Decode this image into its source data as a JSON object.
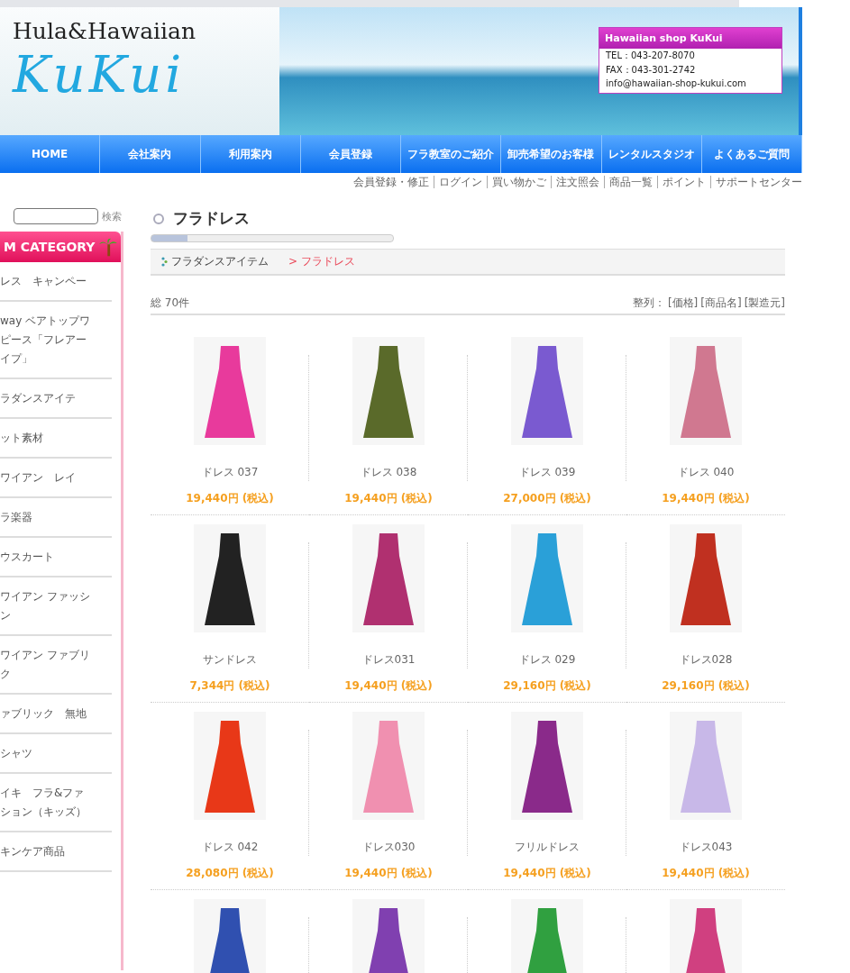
{
  "header": {
    "logo_top": "Hula&Hawaiian",
    "logo_main": "KuKui",
    "info": {
      "title": "Hawaiian shop KuKui",
      "lines": [
        "TEL：043-207-8070",
        "FAX：043-301-2742",
        "info@hawaiian-shop-kukui.com"
      ]
    }
  },
  "nav": [
    "HOME",
    "会社案内",
    "利用案内",
    "会員登録",
    "フラ教室のご紹介",
    "卸売希望のお客様",
    "レンタルスタジオ",
    "よくあるご質問"
  ],
  "sub_links": [
    "会員登録・修正",
    "ログイン",
    "買い物かご",
    "注文照会",
    "商品一覧",
    "ポイント",
    "サポートセンター"
  ],
  "sidebar": {
    "search_button": "検索",
    "category_title": "M CATEGORY",
    "items": [
      {
        "lines": [
          "レス　キャンペー"
        ]
      },
      {
        "lines": [
          "way ベアトップワ",
          "ピース「フレアー",
          "イプ」"
        ]
      },
      {
        "lines": [
          "ラダンスアイテ"
        ]
      },
      {
        "lines": [
          "ット素材"
        ]
      },
      {
        "lines": [
          "ワイアン　レイ"
        ]
      },
      {
        "lines": [
          "ラ楽器"
        ]
      },
      {
        "lines": [
          "ウスカート"
        ]
      },
      {
        "lines": [
          "ワイアン ファッシ",
          "ン"
        ]
      },
      {
        "lines": [
          "ワイアン ファブリ",
          "ク"
        ]
      },
      {
        "lines": [
          "ァブリック　無地"
        ]
      },
      {
        "lines": [
          "シャツ"
        ]
      },
      {
        "lines": [
          "イキ　フラ&ファ",
          "ション（キッズ）"
        ]
      },
      {
        "lines": [
          "キンケア商品"
        ]
      }
    ]
  },
  "page_title": "フラドレス",
  "breadcrumb": {
    "parent": "フラダンスアイテム",
    "current": "> フラドレス"
  },
  "count": "総 70件",
  "sort": {
    "label": "整列：",
    "options": [
      "[価格]",
      "[商品名]",
      "[製造元]"
    ]
  },
  "products": [
    {
      "name": "ドレス 037",
      "price": "19,440円 (税込)",
      "color": "#e83a9c"
    },
    {
      "name": "ドレス 038",
      "price": "19,440円 (税込)",
      "color": "#5a6a2a"
    },
    {
      "name": "ドレス 039",
      "price": "27,000円 (税込)",
      "color": "#7a5ad0"
    },
    {
      "name": "ドレス 040",
      "price": "19,440円 (税込)",
      "color": "#d07890"
    },
    {
      "name": "サンドレス",
      "price": "7,344円 (税込)",
      "color": "#222222"
    },
    {
      "name": "ドレス031",
      "price": "19,440円 (税込)",
      "color": "#b03070"
    },
    {
      "name": "ドレス 029",
      "price": "29,160円 (税込)",
      "color": "#2aa0d8"
    },
    {
      "name": "ドレス028",
      "price": "29,160円 (税込)",
      "color": "#c03020"
    },
    {
      "name": "ドレス 042",
      "price": "28,080円 (税込)",
      "color": "#e83818"
    },
    {
      "name": "ドレス030",
      "price": "19,440円 (税込)",
      "color": "#f090b0"
    },
    {
      "name": "フリルドレス",
      "price": "19,440円 (税込)",
      "color": "#8a2a8a"
    },
    {
      "name": "ドレス043",
      "price": "19,440円 (税込)",
      "color": "#c8b8e8"
    },
    {
      "color": "#3050b0"
    },
    {
      "color": "#8040b0"
    },
    {
      "color": "#30a040"
    },
    {
      "color": "#d04080"
    }
  ]
}
